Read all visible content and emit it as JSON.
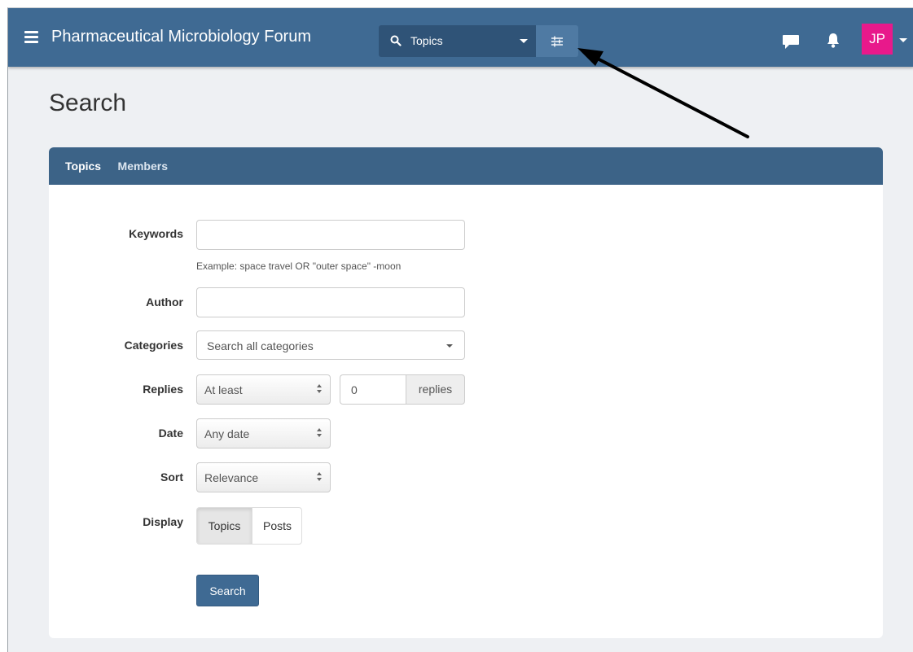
{
  "navbar": {
    "brand": "Pharmaceutical Microbiology Forum",
    "search_scope": "Topics",
    "avatar_initials": "JP",
    "colors": {
      "bar": "#3f6a93",
      "avatar": "#e8198b"
    }
  },
  "page": {
    "title": "Search"
  },
  "tabs": [
    {
      "label": "Topics",
      "active": true
    },
    {
      "label": "Members",
      "active": false
    }
  ],
  "form": {
    "keywords": {
      "label": "Keywords",
      "value": "",
      "help": "Example: space travel OR \"outer space\" -moon"
    },
    "author": {
      "label": "Author",
      "value": ""
    },
    "categories": {
      "label": "Categories",
      "value": "Search all categories"
    },
    "replies": {
      "label": "Replies",
      "mode": "At least",
      "count": "0",
      "unit": "replies"
    },
    "date": {
      "label": "Date",
      "value": "Any date"
    },
    "sort": {
      "label": "Sort",
      "value": "Relevance"
    },
    "display": {
      "label": "Display",
      "options": [
        "Topics",
        "Posts"
      ],
      "selected": "Topics"
    },
    "submit_label": "Search"
  }
}
